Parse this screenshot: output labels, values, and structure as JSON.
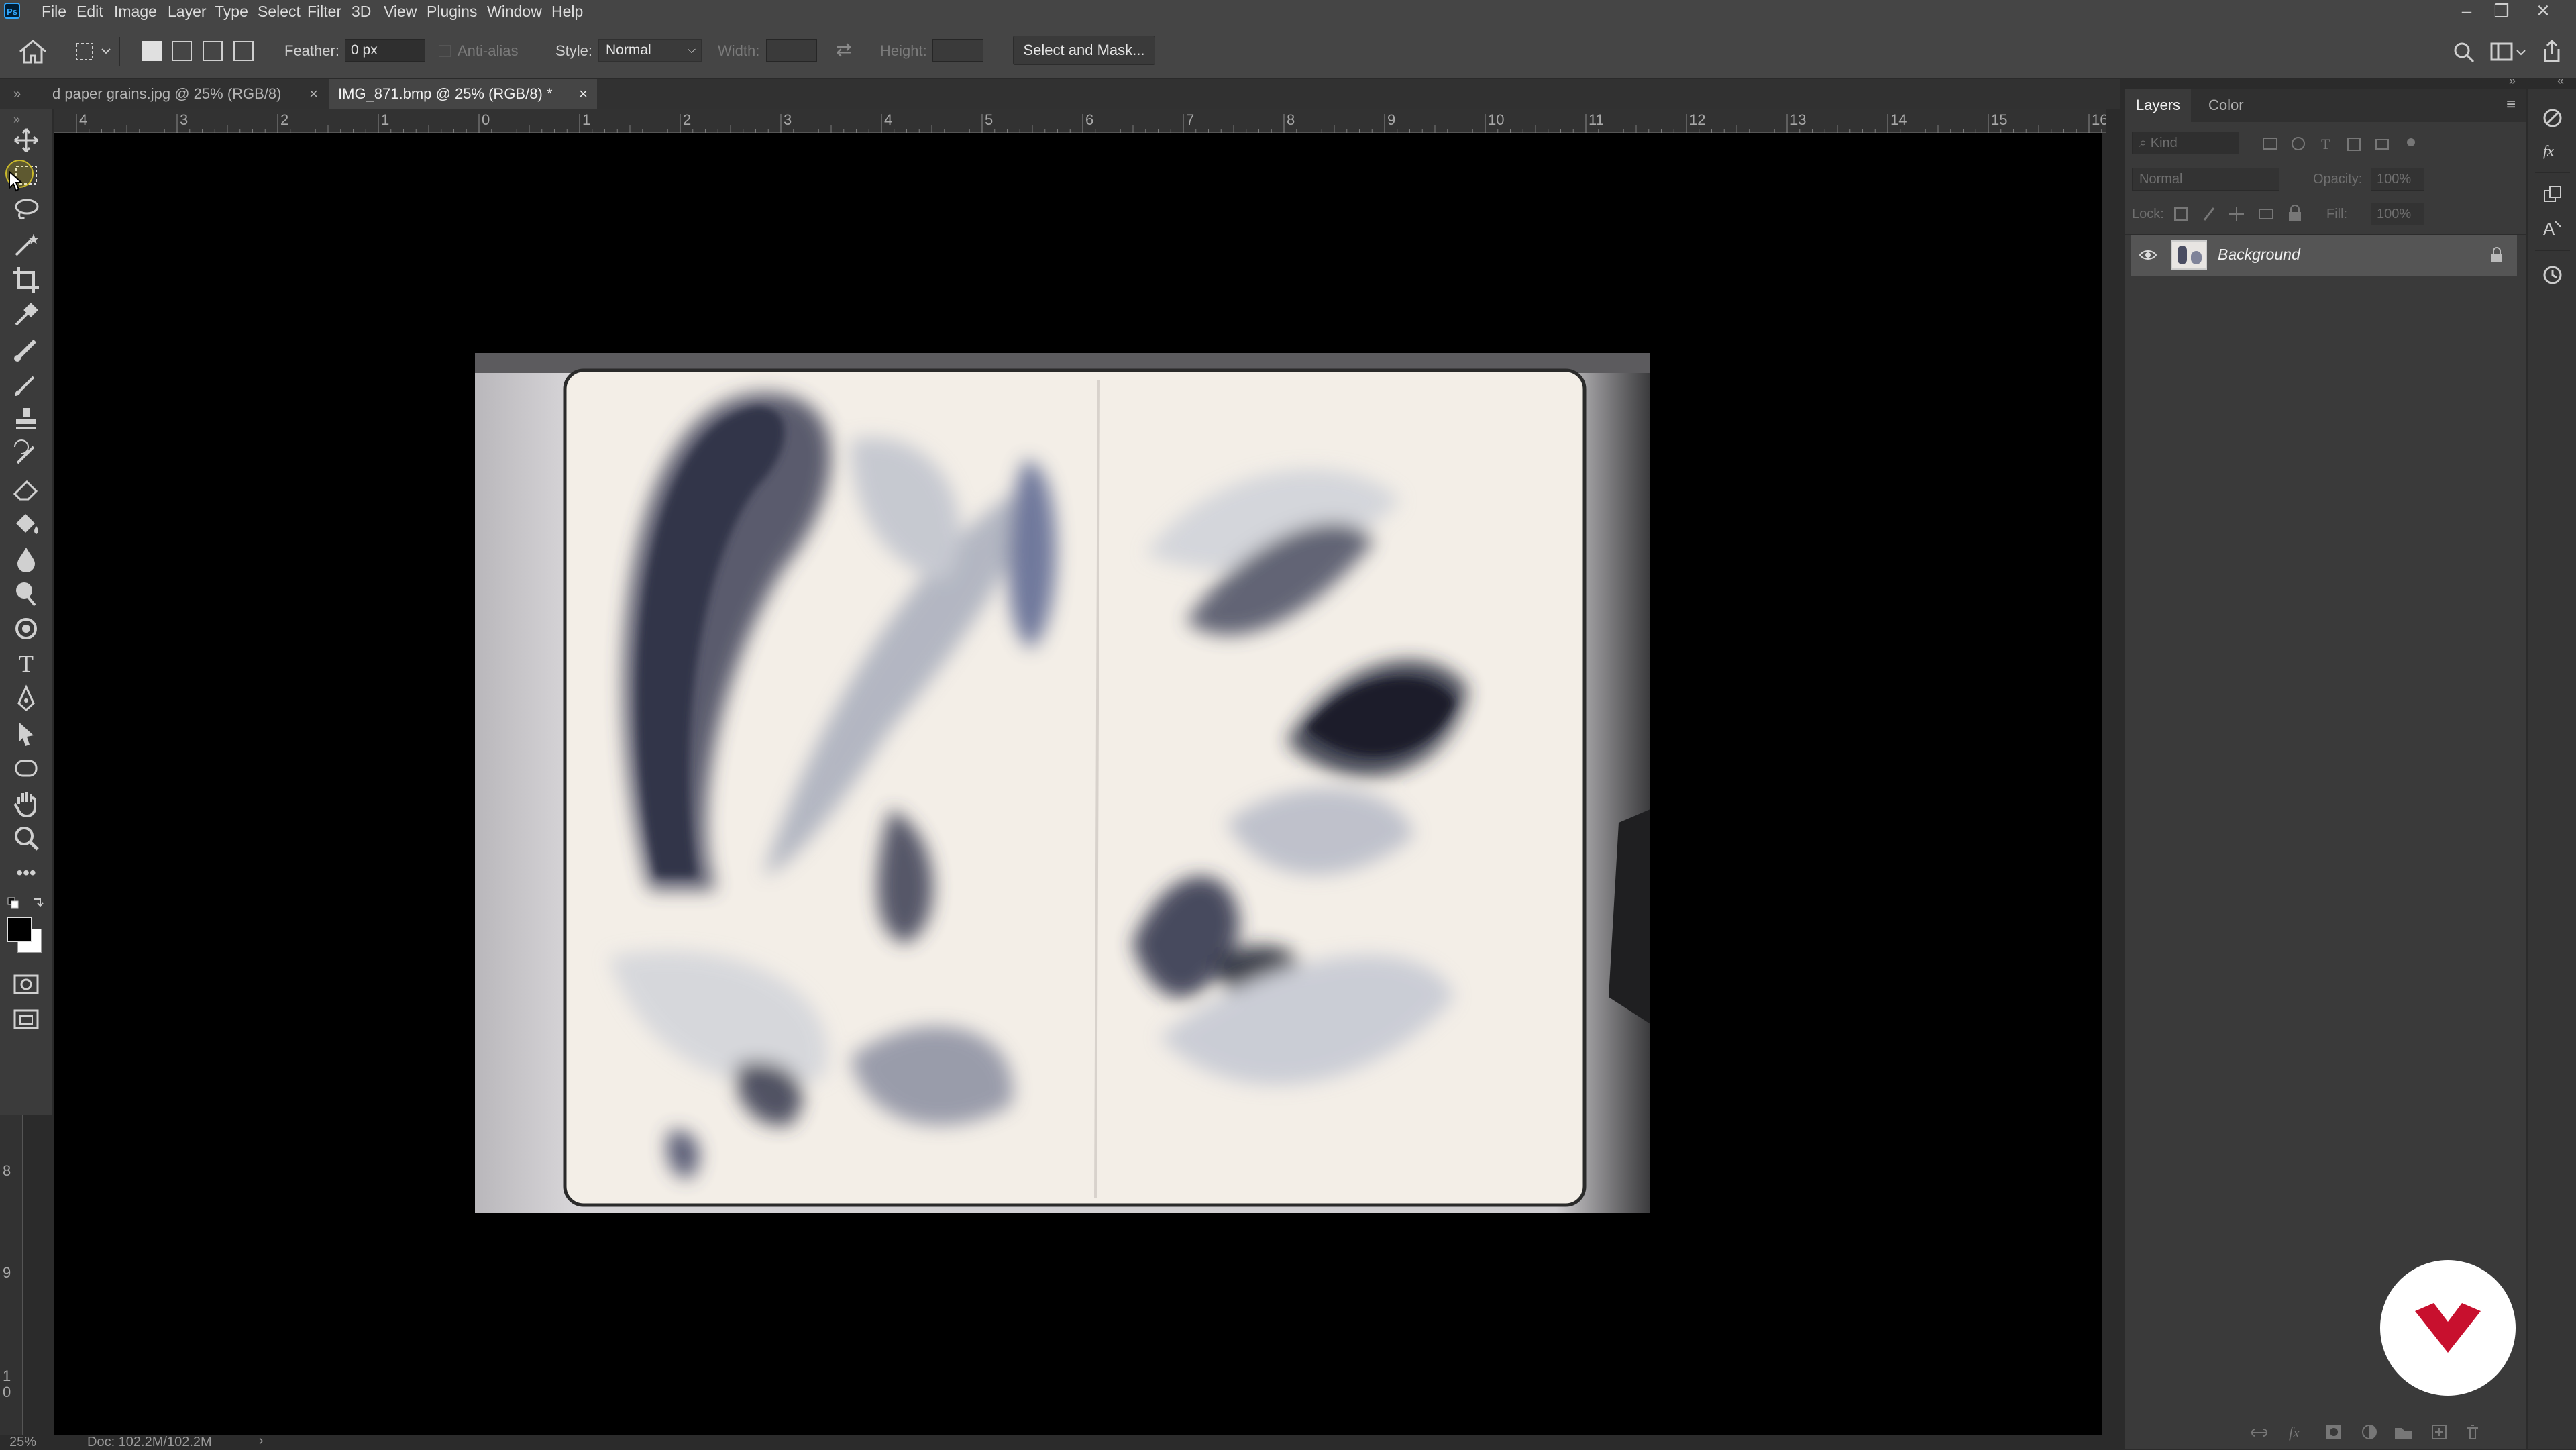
{
  "app": {
    "logo_text": "Ps"
  },
  "menu": [
    "File",
    "Edit",
    "Image",
    "Layer",
    "Type",
    "Select",
    "Filter",
    "3D",
    "View",
    "Plugins",
    "Window",
    "Help"
  ],
  "options_bar": {
    "feather_label": "Feather:",
    "feather_value": "0 px",
    "antialias_label": "Anti-alias",
    "style_label": "Style:",
    "style_value": "Normal",
    "width_label": "Width:",
    "height_label": "Height:",
    "select_mask_label": "Select and Mask..."
  },
  "tabs": [
    {
      "label": "d paper grains.jpg @ 25% (RGB/8)",
      "close": "×",
      "active": false
    },
    {
      "label": "IMG_871.bmp @ 25% (RGB/8) *",
      "close": "×",
      "active": true
    }
  ],
  "ruler_h_labels": [
    "4",
    "3",
    "2",
    "1",
    "0",
    "1",
    "2",
    "3",
    "4",
    "5",
    "6",
    "7",
    "8",
    "9",
    "10",
    "11",
    "12",
    "13",
    "14",
    "15",
    "16"
  ],
  "ruler_v_labels": [
    "8",
    "9",
    "1",
    "0"
  ],
  "layers_panel": {
    "tabs": [
      "Layers",
      "Color"
    ],
    "filter_kind": "Kind",
    "blend_mode": "Normal",
    "opacity_label": "Opacity:",
    "opacity_value": "100%",
    "lock_label": "Lock:",
    "fill_label": "Fill:",
    "fill_value": "100%",
    "layers": [
      {
        "name": "Background",
        "visible": true,
        "locked": true
      }
    ]
  },
  "status": {
    "zoom": "25%",
    "doc": "Doc: 102.2M/102.2M",
    "arrow": "›"
  },
  "colors": {
    "accent_brand": "#c8102e",
    "ps_blue": "#31a8ff"
  }
}
